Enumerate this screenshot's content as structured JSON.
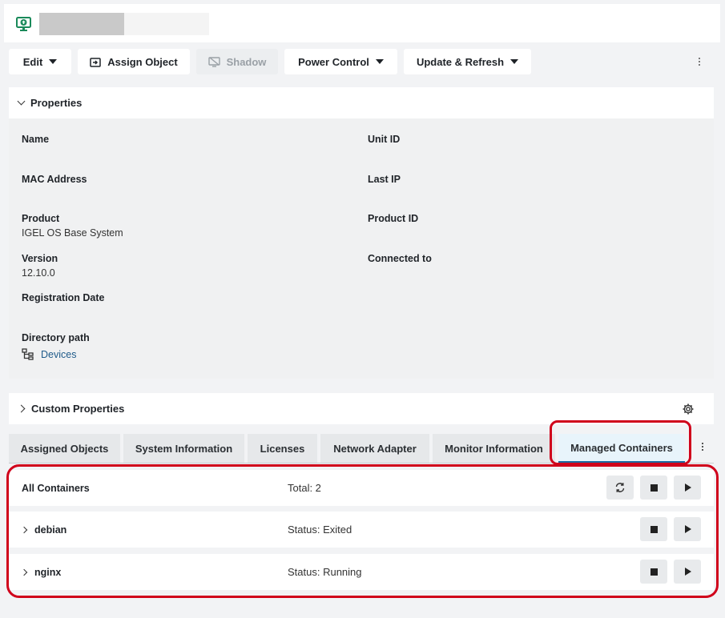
{
  "header": {
    "icon": "monitor-upload-icon"
  },
  "toolbar": {
    "edit_label": "Edit",
    "assign_label": "Assign Object",
    "shadow_label": "Shadow",
    "power_label": "Power Control",
    "update_label": "Update & Refresh"
  },
  "properties": {
    "title": "Properties",
    "name_label": "Name",
    "unit_id_label": "Unit ID",
    "mac_label": "MAC Address",
    "last_ip_label": "Last IP",
    "product_label": "Product",
    "product_value": "IGEL OS Base System",
    "product_id_label": "Product ID",
    "version_label": "Version",
    "version_value": "12.10.0",
    "connected_label": "Connected to",
    "registration_label": "Registration Date",
    "directory_label": "Directory path",
    "directory_value": "Devices"
  },
  "custom_properties": {
    "title": "Custom Properties"
  },
  "tabs": {
    "assigned": "Assigned Objects",
    "system": "System Information",
    "licenses": "Licenses",
    "network": "Network Adapter",
    "monitor": "Monitor Information",
    "containers": "Managed Containers"
  },
  "containers": {
    "all_label": "All Containers",
    "total_text": "Total: 2",
    "rows": [
      {
        "name": "debian",
        "status": "Status: Exited"
      },
      {
        "name": "nginx",
        "status": "Status: Running"
      }
    ]
  },
  "colors": {
    "highlight": "#d0021b",
    "link": "#1f5b8a",
    "icon_green": "#1a8a5a"
  }
}
